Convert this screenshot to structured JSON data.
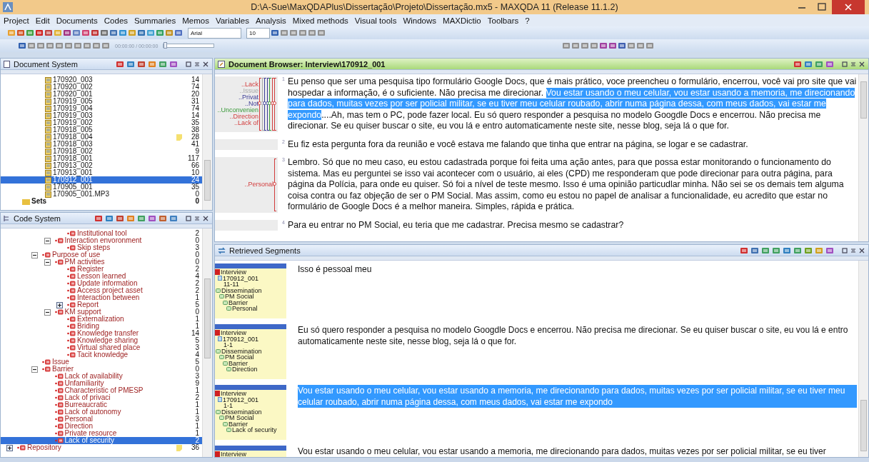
{
  "window": {
    "title": "D:\\A-Sue\\MaxQDAPlus\\Dissertação\\Projeto\\Dissertação.mx5 - MAXQDA 11  (Release 11.1.2)"
  },
  "menu": [
    "Project",
    "Edit",
    "Documents",
    "Codes",
    "Summaries",
    "Memos",
    "Variables",
    "Analysis",
    "Mixed methods",
    "Visual tools",
    "Windows",
    "MAXDictio",
    "Toolbars",
    "?"
  ],
  "toolbar": {
    "font": "Arial",
    "font_size": "10",
    "media_time": "00:00:00 / 00:00:00",
    "media_position": {
      "level": 0
    }
  },
  "document_system": {
    "title": "Document System",
    "documents": [
      {
        "name": "170920_003",
        "count": "14",
        "selected": false,
        "memo": false
      },
      {
        "name": "170920_002",
        "count": "74",
        "selected": false,
        "memo": false
      },
      {
        "name": "170920_001",
        "count": "20",
        "selected": false,
        "memo": false
      },
      {
        "name": "170919_005",
        "count": "31",
        "selected": false,
        "memo": false
      },
      {
        "name": "170919_004",
        "count": "74",
        "selected": false,
        "memo": false
      },
      {
        "name": "170919_003",
        "count": "14",
        "selected": false,
        "memo": false
      },
      {
        "name": "170919_002",
        "count": "35",
        "selected": false,
        "memo": false
      },
      {
        "name": "170918_005",
        "count": "38",
        "selected": false,
        "memo": false
      },
      {
        "name": "170918_004",
        "count": "28",
        "selected": false,
        "memo": true
      },
      {
        "name": "170918_003",
        "count": "41",
        "selected": false,
        "memo": false
      },
      {
        "name": "170918_002",
        "count": "9",
        "selected": false,
        "memo": false
      },
      {
        "name": "170918_001",
        "count": "117",
        "selected": false,
        "memo": false
      },
      {
        "name": "170913_002",
        "count": "66",
        "selected": false,
        "memo": false
      },
      {
        "name": "170913_001",
        "count": "10",
        "selected": false,
        "memo": false
      },
      {
        "name": "170912_001",
        "count": "24",
        "selected": true,
        "memo": false
      },
      {
        "name": "170905_001",
        "count": "35",
        "selected": false,
        "memo": false
      },
      {
        "name": "170905_001.MP3",
        "count": "0",
        "selected": false,
        "memo": false
      }
    ],
    "sets": {
      "name": "Sets",
      "count": "0"
    }
  },
  "code_system": {
    "title": "Code System",
    "codes": [
      {
        "children": [
          {
            "children": [
              {
                "children": [
                  {
                    "children": [
                      {
                        "name": "Institutional tool",
                        "count": "2",
                        "selected": false,
                        "memo": false
                      }
                    ]
                  },
                  {
                    "name": "Interaction envoronment",
                    "count": "0",
                    "expanded": true,
                    "selected": false,
                    "memo": false,
                    "children": [
                      {
                        "name": "Skip steps",
                        "count": "3",
                        "selected": false,
                        "memo": false
                      }
                    ]
                  }
                ]
              },
              {
                "name": "Purpose of use",
                "count": "0",
                "expanded": true,
                "selected": false,
                "memo": false,
                "children": [
                  {
                    "name": "PM activities",
                    "count": "0",
                    "expanded": true,
                    "selected": false,
                    "memo": false,
                    "children": [
                      {
                        "name": "Register",
                        "count": "2",
                        "selected": false,
                        "memo": false
                      },
                      {
                        "name": "Lesson learned",
                        "count": "4",
                        "selected": false,
                        "memo": false
                      },
                      {
                        "name": "Update information",
                        "count": "2",
                        "selected": false,
                        "memo": false
                      },
                      {
                        "name": "Access project asset",
                        "count": "2",
                        "selected": false,
                        "memo": false
                      },
                      {
                        "name": "Interaction between",
                        "count": "1",
                        "selected": false,
                        "memo": false
                      },
                      {
                        "name": "Report",
                        "count": "5",
                        "expanded": false,
                        "selected": false,
                        "memo": false
                      }
                    ]
                  },
                  {
                    "name": "KM support",
                    "count": "0",
                    "expanded": true,
                    "selected": false,
                    "memo": false,
                    "children": [
                      {
                        "name": "Externalization",
                        "count": "1",
                        "selected": false,
                        "memo": false
                      },
                      {
                        "name": "Briding",
                        "count": "1",
                        "selected": false,
                        "memo": false
                      },
                      {
                        "name": "Knowledge transfer",
                        "count": "14",
                        "selected": false,
                        "memo": false
                      },
                      {
                        "name": "Knowledge sharing",
                        "count": "5",
                        "selected": false,
                        "memo": false
                      },
                      {
                        "name": "Virtual shared place",
                        "count": "3",
                        "selected": false,
                        "memo": false
                      },
                      {
                        "name": "Tacit knowledge",
                        "count": "4",
                        "selected": false,
                        "memo": false
                      }
                    ]
                  }
                ]
              },
              {
                "name": "Issue",
                "count": "5",
                "selected": false,
                "memo": false
              },
              {
                "name": "Barrier",
                "count": "0",
                "expanded": true,
                "selected": false,
                "memo": false,
                "children": [
                  {
                    "name": "Lack of availability",
                    "count": "3",
                    "selected": false,
                    "memo": false
                  },
                  {
                    "name": "Unfamiliarity",
                    "count": "9",
                    "selected": false,
                    "memo": false
                  },
                  {
                    "name": "Characteristic of PMESP",
                    "count": "1",
                    "selected": false,
                    "memo": false
                  },
                  {
                    "name": "Lack of privaci",
                    "count": "2",
                    "selected": false,
                    "memo": false
                  },
                  {
                    "name": "Burreaucratic",
                    "count": "1",
                    "selected": false,
                    "memo": false
                  },
                  {
                    "name": "Lack of autonomy",
                    "count": "1",
                    "selected": false,
                    "memo": false
                  },
                  {
                    "name": "Personal",
                    "count": "3",
                    "selected": false,
                    "memo": false
                  },
                  {
                    "name": "Direction",
                    "count": "1",
                    "selected": false,
                    "memo": false
                  },
                  {
                    "name": "Private resource",
                    "count": "1",
                    "selected": false,
                    "memo": false
                  },
                  {
                    "name": "Lack of security",
                    "count": "2",
                    "selected": true,
                    "memo": false
                  }
                ]
              }
            ]
          }
        ]
      },
      {
        "name": "Repository",
        "count": "36",
        "expanded": false,
        "selected": false,
        "memo": true
      }
    ]
  },
  "document_browser": {
    "title": "Document Browser: Interview\\170912_001",
    "paragraphs": [
      {
        "number": "1",
        "codes": [
          {
            "label": "..Lack",
            "color": "#d23c3c"
          },
          {
            "label": "..Issue",
            "color": "#a8a8a8"
          },
          {
            "label": "..Privat",
            "color": "#3c3c96"
          },
          {
            "label": "..Not",
            "color": "#3c3c96"
          },
          {
            "label": "..Unconvenien",
            "color": "#3a9a3a"
          },
          {
            "label": "..Direction",
            "color": "#d23c3c"
          },
          {
            "label": "..Lack of",
            "color": "#d23c3c"
          }
        ],
        "segments": [
          {
            "text": "Eu penso que ser uma pesquisa tipo formulário Google Docs, que é mais prático, voce preencheu o formulário, encerrou, você vai pro site que vai hospedar a informação, é o suficiente. Não precisa me direcionar. ",
            "selected": false
          },
          {
            "text": "Vou estar usando o meu celular, vou estar usando a memoria, me direcionando para dados, muitas vezes por ser policial militar, se eu tiver meu celular roubado, abrir numa página dessa, com meus dados, vai estar me expondo",
            "selected": true
          },
          {
            "text": "....Ah, mas tem o PC, pode fazer local. Eu só quero responder a pesquisa no modelo Googdle Docs e encerrou. Não precisa me direcionar. Se eu quiser buscar o site, eu vou lá e entro automaticamente neste site, nesse blog, seja lá o que for.",
            "selected": false
          }
        ]
      },
      {
        "number": "2",
        "segments": [
          {
            "text": "Eu fiz esta pergunta fora da reunião e você estava me falando que tinha que entrar na página, se logar e se cadastrar.",
            "selected": false
          }
        ]
      },
      {
        "number": "3",
        "codes": [
          {
            "label": "..Personal",
            "color": "#d23c3c"
          }
        ],
        "segments": [
          {
            "text": "Lembro. Só que no meu caso, eu estou cadastrada porque foi feita uma ação antes, para que possa estar monitorando o funcionamento do sistema. Mas eu perguntei se isso vai acontecer com o usuário, ai eles (CPD) me responderam que pode direcionar para outra página, para página da Polícia, para onde eu quiser. Só foi a nível de teste mesmo. Isso é uma opinião particudlar minha. Não sei se os demais tem alguma coisa contra ou faz objeção de ser o PM Social. Mas assim, como eu estou no papel de analisar a funcionalidade, eu acredito que estar no formulário de Google Docs é a melhor maneira. Simples, rápida e prática.",
            "selected": false
          }
        ]
      },
      {
        "number": "4",
        "segments": [
          {
            "text": "Para eu entrar no PM Social, eu teria que me cadastrar. Precisa mesmo se cadastrar?",
            "selected": false
          }
        ]
      }
    ]
  },
  "retrieved_segments": {
    "title": "Retrieved Segments",
    "segments": [
      {
        "group": "Interview",
        "document": "170912_001",
        "range": "11-11",
        "codes": [
          "Dissemination",
          "PM Social",
          "Barrier",
          "Personal"
        ],
        "text": "Isso é pessoal meu",
        "selected": false
      },
      {
        "group": "Interview",
        "document": "170912_001",
        "range": "1-1",
        "codes": [
          "Dissemination",
          "PM Social",
          "Barrier",
          "Direction"
        ],
        "text": "Eu só quero responder a pesquisa no modelo Googdle Docs e encerrou. Não precisa me direcionar. Se eu quiser buscar o site, eu vou lá e entro automaticamente neste site, nesse blog, seja lá o que for.",
        "selected": false
      },
      {
        "group": "Interview",
        "document": "170912_001",
        "range": "1-1",
        "codes": [
          "Dissemination",
          "PM Social",
          "Barrier",
          "Lack of security"
        ],
        "text": " Vou estar usando o meu celular, vou estar usando a memoria, me direcionando para dados, muitas vezes por ser policial militar, se eu tiver meu celular roubado, abrir numa página dessa, com meus dados, vai estar me expondo",
        "selected": true
      },
      {
        "group": "Interview",
        "text": "Vou estar usando o meu celular, vou estar usando a memoria, me direcionando para dados, muitas vezes por ser policial militar, se eu tiver",
        "selected": false
      }
    ]
  }
}
